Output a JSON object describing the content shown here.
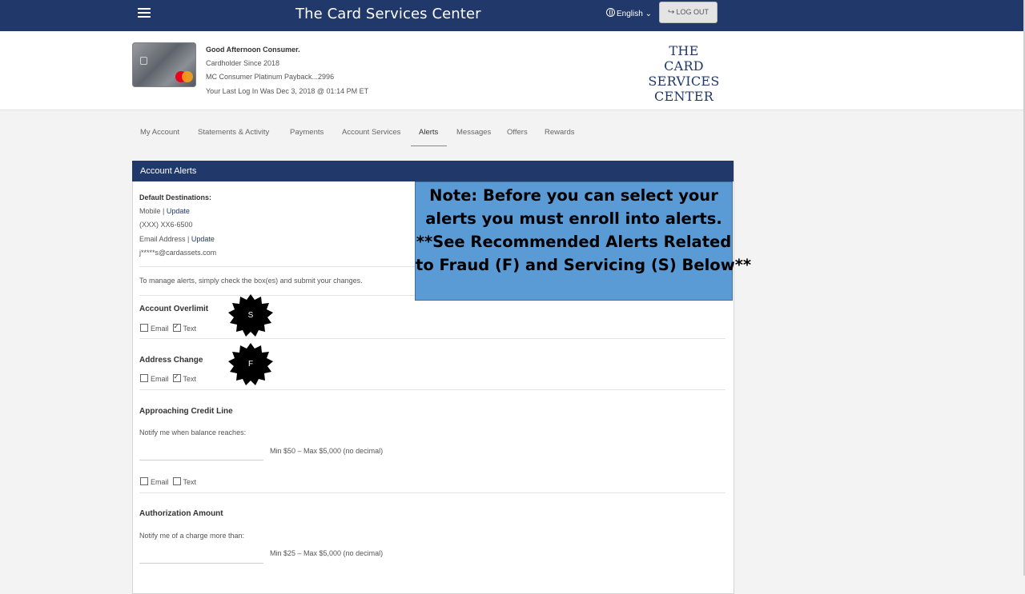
{
  "topbar": {
    "title": "The Card Services Center",
    "language": "English",
    "logout_label": "LOG OUT"
  },
  "header": {
    "greeting": "Good Afternoon Consumer.",
    "cardholder_since": "Cardholder Since 2018",
    "card_name": "MC Consumer Platinum Payback...2996",
    "last_login": "Your Last Log In Was Dec 3, 2018 @ 01:14 PM ET",
    "logo_lines": [
      "THE",
      "CARD SERVICES",
      "CENTER"
    ]
  },
  "tabs": [
    {
      "label": "My Account"
    },
    {
      "label": "Statements & Activity"
    },
    {
      "label": "Payments"
    },
    {
      "label": "Account Services"
    },
    {
      "label": "Alerts",
      "active": true
    },
    {
      "label": "Messages"
    },
    {
      "label": "Offers"
    },
    {
      "label": "Rewards"
    }
  ],
  "panel": {
    "title": "Account Alerts",
    "default_destinations_label": "Default Destinations:",
    "mobile_label": "Mobile",
    "update_label": "Update",
    "mobile_value": "(XXX) XX6-6500",
    "email_label": "Email Address",
    "email_value": "j*****s@cardassets.com",
    "instructions": "To manage alerts, simply check the box(es) and submit your changes.",
    "email_option": "Email",
    "text_option": "Text",
    "sections": [
      {
        "title": "Account Overlimit",
        "email_checked": false,
        "text_checked": true,
        "badge": "S"
      },
      {
        "title": "Address Change",
        "email_checked": false,
        "text_checked": true,
        "badge": "F"
      },
      {
        "title": "Approaching Credit Line",
        "prompt": "Notify me when balance reaches:",
        "hint": "Min $50 – Max $5,000 (no decimal)",
        "email_checked": false,
        "text_checked": false
      },
      {
        "title": "Authorization Amount",
        "prompt": "Notify me of a charge more than:",
        "hint": "Min $25 – Max $5,000 (no decimal)"
      }
    ]
  },
  "note": {
    "lines": [
      "Note: Before you can select your",
      "alerts you must enroll into alerts.",
      "**See Recommended Alerts Related",
      "to Fraud (F) and Servicing (S) Below**"
    ]
  },
  "colors": {
    "navy": "#21386a",
    "note_blue": "#5b9bd5",
    "badge_black": "#000000"
  },
  "icons": {
    "menu": "hamburger-icon",
    "language": "globe-icon",
    "logout": "logout-icon",
    "dropdown": "chevron-down-icon"
  }
}
